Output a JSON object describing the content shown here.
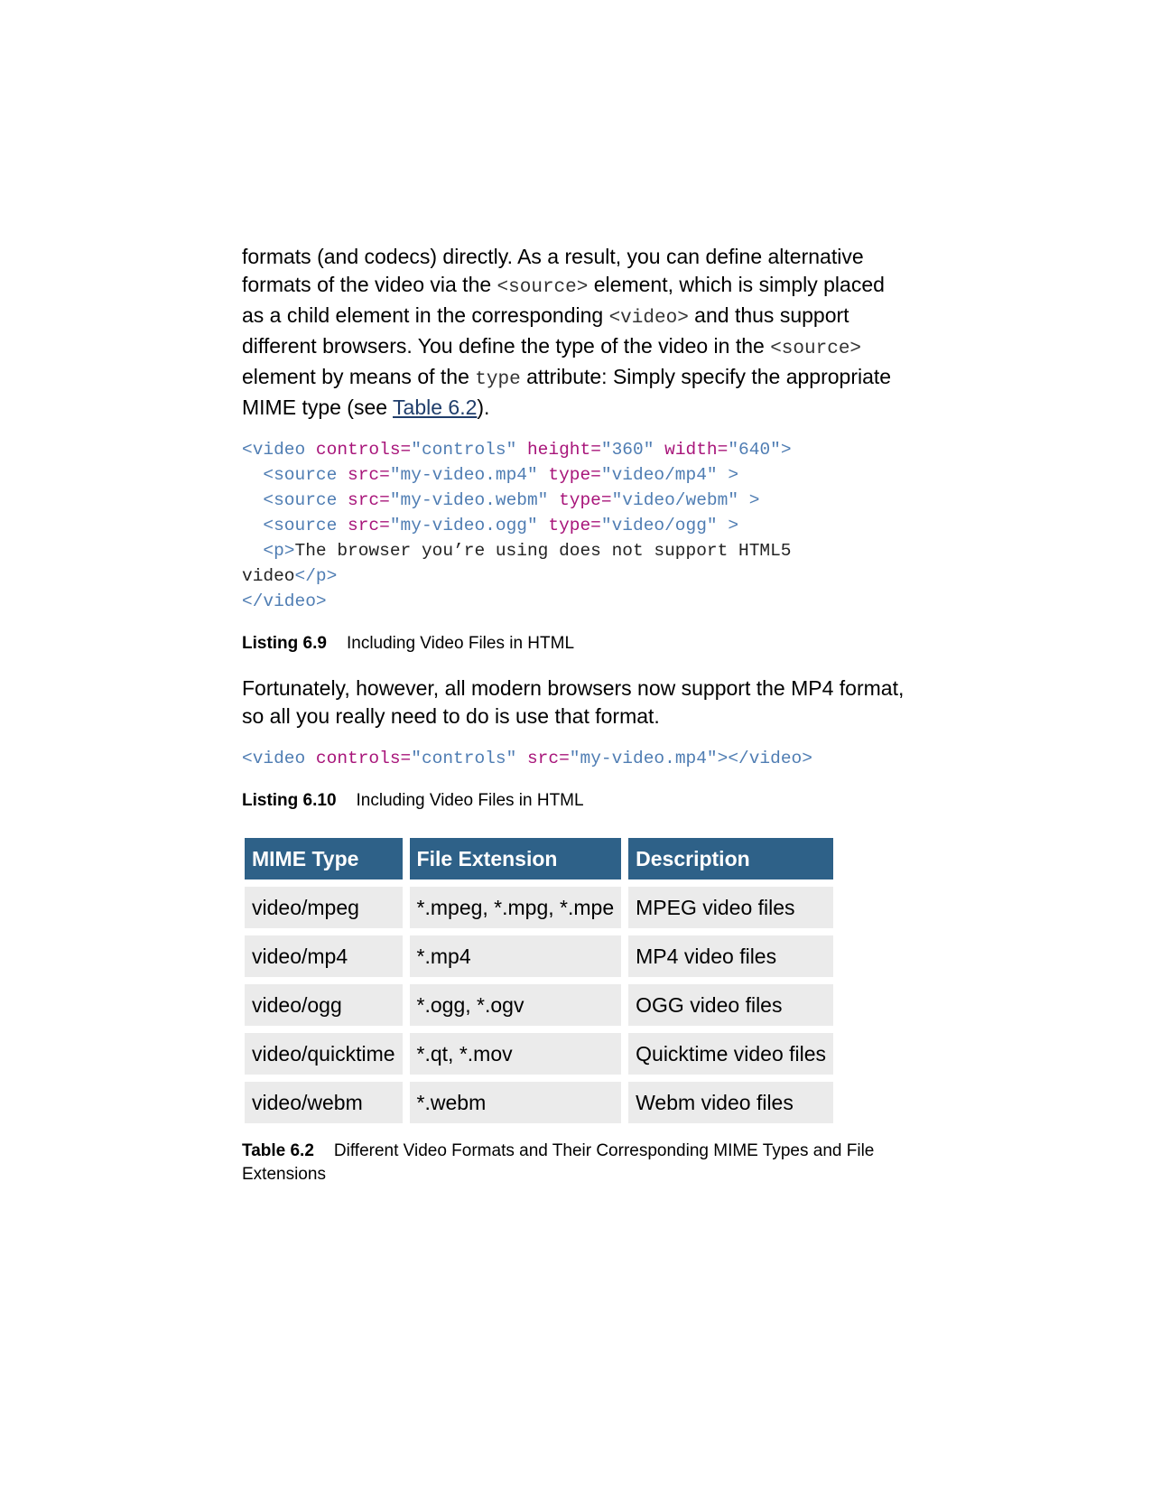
{
  "intro": {
    "t1": "formats (and codecs) directly. As a result, you can define alternative formats of the video via the ",
    "c1": "<source>",
    "t2": " element, which is simply placed as a child element in the corresponding ",
    "c2": "<video>",
    "t3": " and thus support different browsers. You define the type of the video in the ",
    "c3": "<source>",
    "t4": " element by means of the ",
    "c4": "type",
    "t5": " attribute: Simply specify the appropriate MIME type (see ",
    "link": "Table 6.2",
    "t6": ")."
  },
  "listing1": {
    "l1": {
      "a": "<video ",
      "b": "controls=",
      "c": "\"controls\" ",
      "d": "height=",
      "e": "\"360\" ",
      "f": "width=",
      "g": "\"640\">"
    },
    "l2": {
      "a": "  <source ",
      "b": "src=",
      "c": "\"my-video.mp4\" ",
      "d": "type=",
      "e": "\"video/mp4\" >"
    },
    "l3": {
      "a": "  <source ",
      "b": "src=",
      "c": "\"my-video.webm\" ",
      "d": "type=",
      "e": "\"video/webm\" >"
    },
    "l4": {
      "a": "  <source ",
      "b": "src=",
      "c": "\"my-video.ogg\" ",
      "d": "type=",
      "e": "\"video/ogg\" >"
    },
    "l5": {
      "a": "  <p>",
      "b": "The browser you’re using does not support HTML5"
    },
    "l6": {
      "a": "video",
      "b": "</p>"
    },
    "l7": {
      "a": "</video>"
    }
  },
  "caption1": {
    "label": "Listing 6.9",
    "text": "Including Video Files in HTML"
  },
  "para2": "Fortunately, however, all modern browsers now support the MP4 format, so all you really need to do is use that format.",
  "listing2": {
    "a": "<video ",
    "b": "controls=",
    "c": "\"controls\" ",
    "d": "src=",
    "e": "\"my-video.mp4\"></video>"
  },
  "caption2": {
    "label": "Listing 6.10",
    "text": "Including Video Files in HTML"
  },
  "table": {
    "headers": [
      "MIME Type",
      "File Extension",
      "Description"
    ],
    "rows": [
      [
        "video/mpeg",
        "*.mpeg, *.mpg, *.mpe",
        "MPEG video files"
      ],
      [
        "video/mp4",
        "*.mp4",
        "MP4 video files"
      ],
      [
        "video/ogg",
        "*.ogg, *.ogv",
        "OGG video files"
      ],
      [
        "video/quicktime",
        "*.qt, *.mov",
        "Quicktime video files"
      ],
      [
        "video/webm",
        "*.webm",
        "Webm video files"
      ]
    ]
  },
  "caption3": {
    "label": "Table 6.2",
    "text": "Different Video Formats and Their Corresponding MIME Types and File Extensions"
  }
}
